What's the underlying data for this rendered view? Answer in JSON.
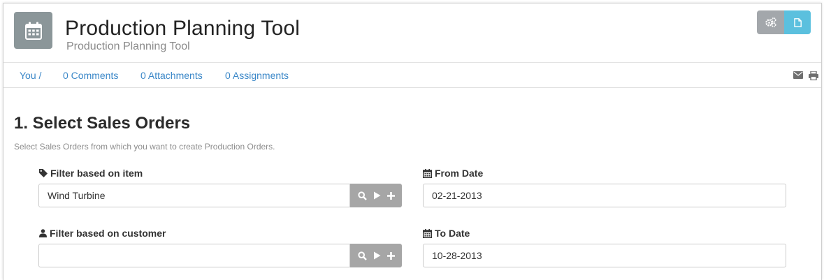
{
  "header": {
    "title": "Production Planning Tool",
    "subtitle": "Production Planning Tool",
    "app_icon": "calendar-icon",
    "buttons": [
      {
        "icon": "gears-icon",
        "color": "#a3a7ab"
      },
      {
        "icon": "document-icon",
        "color": "#5bc0de"
      }
    ]
  },
  "nav": {
    "owner": "You /",
    "comments": "0 Comments",
    "attachments": "0 Attachments",
    "assignments": "0 Assignments",
    "tools": [
      "envelope-icon",
      "print-icon"
    ]
  },
  "section": {
    "title": "1. Select Sales Orders",
    "description": "Select Sales Orders from which you want to create Production Orders."
  },
  "fields": {
    "item": {
      "label": "Filter based on item",
      "value": "Wind Turbine",
      "icon": "tag-icon"
    },
    "customer": {
      "label": "Filter based on customer",
      "value": "",
      "icon": "user-icon"
    },
    "from_date": {
      "label": "From Date",
      "value": "02-21-2013",
      "icon": "calendar-icon"
    },
    "to_date": {
      "label": "To Date",
      "value": "10-28-2013",
      "icon": "calendar-icon"
    }
  },
  "colors": {
    "link": "#3a87c8",
    "icon_tile": "#8b9699",
    "addon": "#a6a6a6"
  }
}
